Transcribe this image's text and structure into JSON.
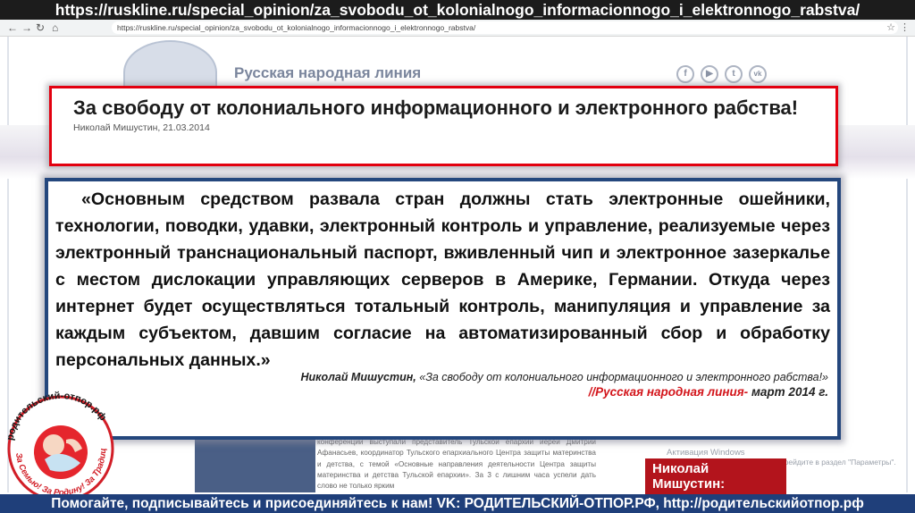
{
  "url_banner": "https://ruskline.ru/special_opinion/za_svobodu_ot_kolonialnogo_informacionnogo_i_elektronnogo_rabstva/",
  "browser": {
    "back_icon": "arrow-left-icon",
    "forward_icon": "arrow-right-icon",
    "reload_icon": "reload-icon",
    "address": "https://ruskline.ru/special_opinion/za_svobodu_ot_kolonialnogo_informacionnogo_i_elektronnogo_rabstva/"
  },
  "site": {
    "name": "Русская народная линия",
    "social_icons": [
      "f",
      "▶",
      "t",
      "vk"
    ]
  },
  "title_box": {
    "title": "За свободу от колониального информационного и электронного рабства!",
    "byline": "Николай Мишустин, 21.03.2014"
  },
  "quote": {
    "text": "«Основным средством развала стран должны стать электронные ошейники, технологии, поводки, удавки, электронный контроль и управление, реализуемые через электронный транснациональный паспорт, вживленный чип и электронное зазеркалье с местом дислокации управляющих серверов в Америке, Германии. Откуда через интернет будет осуществляться тотальный контроль, манипуляция и управление за каждым субъектом, давшим согласие на автоматизированный сбор и обработку персональных данных.»",
    "author": "Николай Мишустин,",
    "work": "«За свободу от колониального информационного и электронного рабства!»",
    "source": "//Русская народная линия-",
    "date": " март 2014 г."
  },
  "article_snippet": "конференции выступали представитель Тульской епархии иерей Дмитрий Афанасьев, координатор Тульского епархиального Центра защиты материнства и детства, с темой «Основные направления деятельности Центра защиты материнства и детства Тульской епархии». За 3 с лишним часа успели дать слово не только ярким",
  "windows_activation": {
    "line1": "Активация Windows",
    "line2": "Чтобы активировать Windows, перейдите в раздел \"Параметры\"."
  },
  "author_box": {
    "line1": "Николай",
    "line2": "Мишустин:"
  },
  "logo": {
    "outer_text": "родительский-отпор.рф",
    "inner_text": "За Семью! За Родину! За Традиции!"
  },
  "bottom_banner": "Помогайте, подписывайтесь и присоединяйтесь к нам! VK: РОДИТЕЛЬСКИЙ-ОТПОР.РФ, http://родительскийотпор.рф",
  "colors": {
    "title_border": "#e3000f",
    "quote_border": "#24477d",
    "source_red": "#d3151b",
    "bottom_banner": "#1f3f7a",
    "author_box": "#b3141c"
  }
}
